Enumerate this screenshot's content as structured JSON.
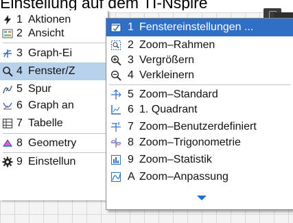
{
  "caption": {
    "text": "Einstellung auf dem TI-Nspire"
  },
  "main_menu": {
    "items": [
      {
        "num": "1",
        "label": "Aktionen",
        "icon": "flash-icon"
      },
      {
        "num": "2",
        "label": "Ansicht",
        "icon": "view-icon"
      },
      {
        "num": "3",
        "label": "Graph-Ei",
        "icon": "graph-entry-icon"
      },
      {
        "num": "4",
        "label": "Fenster/Z",
        "icon": "magnifier-icon"
      },
      {
        "num": "5",
        "label": "Spur",
        "icon": "trace-icon"
      },
      {
        "num": "6",
        "label": "Graph an",
        "icon": "analyze-graph-icon"
      },
      {
        "num": "7",
        "label": "Tabelle",
        "icon": "table-icon"
      },
      {
        "num": "8",
        "label": "Geometry",
        "icon": "geometry-icon"
      },
      {
        "num": "9",
        "label": "Einstellun",
        "icon": "gear-icon"
      }
    ]
  },
  "submenu": {
    "items": [
      {
        "num": "1",
        "label": "Fenstereinstellungen ...",
        "icon": "window-settings-icon"
      },
      {
        "num": "2",
        "label": "Zoom–Rahmen",
        "icon": "zoom-box-icon"
      },
      {
        "num": "3",
        "label": "Vergrößern",
        "icon": "zoom-in-icon"
      },
      {
        "num": "4",
        "label": "Verkleinern",
        "icon": "zoom-out-icon"
      },
      {
        "num": "5",
        "label": "Zoom–Standard",
        "icon": "zoom-standard-icon"
      },
      {
        "num": "6",
        "label": "1. Quadrant",
        "icon": "quadrant-icon"
      },
      {
        "num": "7",
        "label": "Zoom–Benutzerdefiniert",
        "icon": "zoom-user-icon"
      },
      {
        "num": "8",
        "label": "Zoom–Trigonometrie",
        "icon": "zoom-trig-icon"
      },
      {
        "num": "9",
        "label": "Zoom–Statistik",
        "icon": "zoom-stat-icon"
      },
      {
        "num": "A",
        "label": "Zoom–Anpassung",
        "icon": "zoom-fit-icon"
      }
    ]
  },
  "colors": {
    "selected": "#2f6fc6",
    "parent_selected": "#b9d2ec",
    "scroll_arrow": "#1f6fd0"
  }
}
